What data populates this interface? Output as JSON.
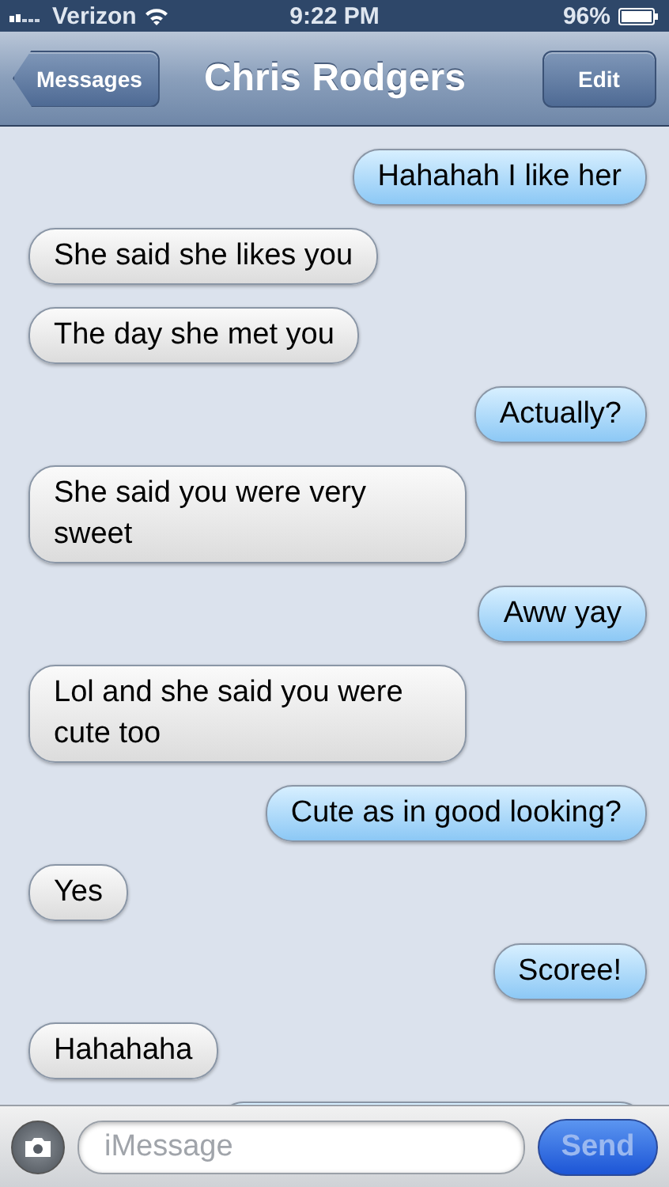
{
  "status_bar": {
    "carrier": "Verizon",
    "time": "9:22 PM",
    "battery": "96%"
  },
  "nav": {
    "back": "Messages",
    "title": "Chris Rodgers",
    "edit": "Edit"
  },
  "messages": [
    {
      "outgoing": true,
      "kind": "text",
      "text": "Hahahah I like her"
    },
    {
      "outgoing": false,
      "kind": "text",
      "text": "She said she likes you"
    },
    {
      "outgoing": false,
      "kind": "text",
      "text": "The day she met you"
    },
    {
      "outgoing": true,
      "kind": "text",
      "text": "Actually?"
    },
    {
      "outgoing": false,
      "kind": "text",
      "text": "She said you were very sweet"
    },
    {
      "outgoing": true,
      "kind": "text",
      "text": "Aww yay"
    },
    {
      "outgoing": false,
      "kind": "text",
      "text": "Lol and she said you were cute too"
    },
    {
      "outgoing": true,
      "kind": "text",
      "text": "Cute as in good looking?"
    },
    {
      "outgoing": false,
      "kind": "text",
      "text": "Yes"
    },
    {
      "outgoing": true,
      "kind": "text",
      "text": "Scoree!"
    },
    {
      "outgoing": false,
      "kind": "text",
      "text": "Hahahaha"
    },
    {
      "outgoing": true,
      "kind": "peek"
    }
  ],
  "composer": {
    "placeholder": "iMessage",
    "send": "Send",
    "send_disabled": true
  }
}
